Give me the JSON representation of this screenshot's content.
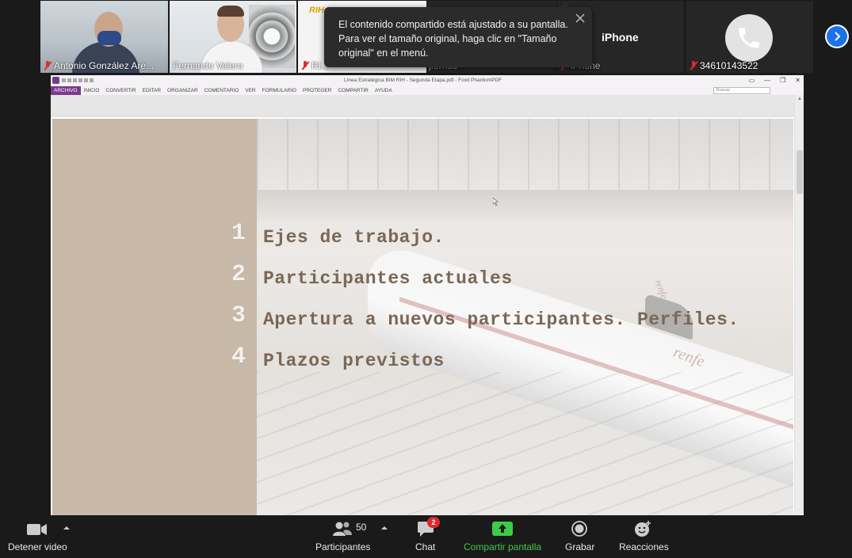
{
  "participants": [
    {
      "name": "Antonio González Are...",
      "muted": true
    },
    {
      "name": "Fernando Valero",
      "muted": false
    },
    {
      "name": "RI...",
      "muted": true
    },
    {
      "name": "jferrico",
      "muted": false
    },
    {
      "name": "iPhone",
      "muted": true,
      "title": "iPhone"
    },
    {
      "name": "34610143522",
      "muted": true
    }
  ],
  "tile3_logo": "RIH",
  "toast": {
    "text": "El contenido compartido está ajustado a su pantalla. Para ver el tamaño original, haga clic en \"Tamaño original\" en el menú."
  },
  "app": {
    "window_title": "Línea Estratégica BIM RIH - Segunda Etapa.pdf - Foxit PhantomPDF",
    "menu": [
      "ARCHIVO",
      "INICIO",
      "CONVERTIR",
      "EDITAR",
      "ORGANIZAR",
      "COMENTARIO",
      "VER",
      "FORMULARIO",
      "PROTEGER",
      "COMPARTIR",
      "AYUDA"
    ],
    "search_placeholder": "Buscar"
  },
  "slide": {
    "items": [
      {
        "num": "1",
        "text": "Ejes de trabajo."
      },
      {
        "num": "2",
        "text": "Participantes actuales"
      },
      {
        "num": "3",
        "text": "Apertura a nuevos participantes. Perfiles."
      },
      {
        "num": "4",
        "text": "Plazos previstos"
      }
    ],
    "train_brand": "renfe"
  },
  "toolbar": {
    "video": "Detener video",
    "participants": "Participantes",
    "participants_count": "50",
    "chat": "Chat",
    "chat_badge": "2",
    "share": "Compartir pantalla",
    "record": "Grabar",
    "reactions": "Reacciones"
  },
  "colors": {
    "accent_green": "#3fcb4a",
    "accent_blue": "#1a73e8",
    "muted_red": "#e02828",
    "foxit_purple": "#7a3a8c",
    "slide_text": "#7a6755"
  }
}
